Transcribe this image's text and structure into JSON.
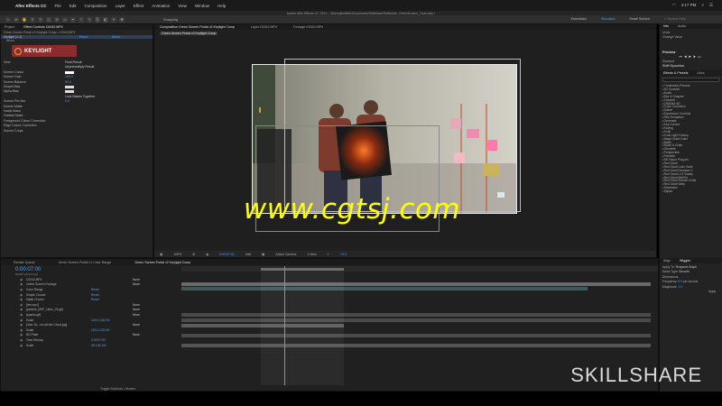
{
  "menubar": {
    "app_name": "After Effects CC",
    "items": [
      "File",
      "Edit",
      "Composition",
      "Layer",
      "Effect",
      "Animation",
      "View",
      "Window",
      "Help"
    ],
    "clock": "4:17 PM"
  },
  "title_path": "Adobe After Effects CC 2014 - /Users/jewilhite/Documents/Skillshare/Skillshare_GreenScreen_Tools.aep *",
  "toolbar": {
    "snapping_label": "Snapping",
    "workspaces": [
      "Essentials",
      "Standard",
      "Small Screen"
    ],
    "active_workspace": "Standard",
    "search_placeholder": "Search Help"
  },
  "effect_controls": {
    "tabs": [
      "Project",
      "Effect Controls C0042.MP4"
    ],
    "breadcrumb": "Green Screen Portal v2 Keylight Comp • C0042.MP4",
    "effect_row": {
      "name": "Keylight (1.2)",
      "reset": "Reset",
      "about": "About..."
    },
    "about_label": "About",
    "keylight_logo_text": "KEYLIGHT",
    "rows": [
      {
        "k": "View",
        "v": "Final Result"
      },
      {
        "k": "",
        "v": "Unpremultiply Result"
      },
      {
        "k": "Screen Colour",
        "v": ""
      },
      {
        "k": "Screen Gain",
        "v": "100.0"
      },
      {
        "k": "Screen Balance",
        "v": "50.0"
      },
      {
        "k": "Despill Bias",
        "v": ""
      },
      {
        "k": "Alpha Bias",
        "v": ""
      },
      {
        "k": "",
        "v": "Lock Biases Together"
      },
      {
        "k": "Screen Pre-blur",
        "v": "0.0"
      },
      {
        "k": "Screen Matte",
        "v": ""
      },
      {
        "k": "Inside Mask",
        "v": ""
      },
      {
        "k": "Outside Mask",
        "v": ""
      },
      {
        "k": "Foreground Colour Correction",
        "v": ""
      },
      {
        "k": "Edge Colour Correction",
        "v": ""
      },
      {
        "k": "Source Crops",
        "v": ""
      }
    ]
  },
  "viewer": {
    "tabs": [
      "Composition Green Screen Portal v2 Keylight Comp",
      "Layer C0042.MP4",
      "Footage C0042.MP4"
    ],
    "active_comp_label": "Green Screen Portal v2 Keylight Comp",
    "bottom_bar": {
      "zoom": "100%",
      "timecode": "0:00:07:01",
      "resolution": "Half",
      "camera": "Active Camera",
      "view": "1 View",
      "exposure": "+0.0"
    }
  },
  "info_panel": {
    "tabs": [
      "Info",
      "Audio"
    ],
    "lines": [
      "Undo",
      "Change Value"
    ],
    "preview_head": "Preview",
    "shortcut_label": "Shortcut",
    "shortcut_value": "Shift+Spacebar",
    "fx_tabs": [
      "Effects & Presets",
      "Libra"
    ],
    "fx_items": [
      "* Animation Presets",
      "3D Channel",
      "Audio",
      "Blur & Sharpen",
      "Channel",
      "CINEMA 4D",
      "Color Correction",
      "Distort",
      "Expression Controls",
      "Film Emulation",
      "Generate",
      "Key Correct",
      "Keying",
      "Knoll",
      "Knoll Light Factory",
      "Magic Bullet Suite",
      "Matte",
      "Noise & Grain",
      "Obsolete",
      "Perspective",
      "Primatte",
      "RE:Vision Plug-ins",
      "Red Giant",
      "Red Giant Color Suite",
      "Red Giant Denoiser II",
      "Red Giant LUT Buddy",
      "Red Giant MisFire",
      "Red Giant Shooter Suite",
      "Red Giant Warp",
      "Simulation",
      "Stylize"
    ]
  },
  "timeline": {
    "tabs": [
      "Render Queue",
      "Green Screen Portal v1 Color Range",
      "Green Screen Portal v2 Keylight Comp"
    ],
    "active_tab": "Green Screen Portal v2 Keylight Comp",
    "timecode": "0:00:07:00",
    "frame_info": "00168 (23.976 fps)",
    "layers": [
      {
        "num": "",
        "name": "C0042.MP4",
        "val": "",
        "mode": "None"
      },
      {
        "num": "",
        "name": "Green Screen Footage",
        "val": "",
        "mode": "None"
      },
      {
        "num": "",
        "name": "Color Range",
        "val": "Reset",
        "mode": ""
      },
      {
        "num": "",
        "name": "Simple Choker",
        "val": "Reset",
        "mode": ""
      },
      {
        "num": "",
        "name": "Matte Choker",
        "val": "Reset",
        "mode": ""
      },
      {
        "num": "",
        "name": "[fire.mp4]",
        "val": "",
        "mode": "None"
      },
      {
        "num": "",
        "name": "[particle_MSF_video_00.gif]",
        "val": "",
        "mode": "None"
      },
      {
        "num": "",
        "name": "[sparks.gif]",
        "val": "",
        "mode": "None"
      },
      {
        "num": "",
        "name": "Scale",
        "val": "100.0,100.0%",
        "mode": ""
      },
      {
        "num": "",
        "name": "[Inter-Sc...ed-off-the-Cloud.jpg]",
        "val": "",
        "mode": "None"
      },
      {
        "num": "",
        "name": "Scale",
        "val": "100.0,100.0%",
        "mode": ""
      },
      {
        "num": "",
        "name": "BG Plate",
        "val": "",
        "mode": "None"
      },
      {
        "num": "",
        "name": "Time Remap",
        "val": "0:00:07:00",
        "mode": ""
      },
      {
        "num": "",
        "name": "Scale",
        "val": "50.0,50.0%",
        "mode": ""
      }
    ],
    "bottom_label": "Toggle Switches / Modes"
  },
  "align_panel": {
    "tabs": [
      "Align",
      "Wiggler"
    ],
    "apply_to_label": "Apply To:",
    "apply_to_value": "Temporal Graph",
    "noise_type_label": "Noise Type:",
    "noise_type_value": "Smooth",
    "dimensions_label": "Dimensions:",
    "frequency_label": "Frequency:",
    "frequency_value": "5.0",
    "frequency_unit": "per second",
    "magnitude_label": "Magnitude:",
    "magnitude_value": "1.0",
    "apply_button": "Apply"
  },
  "watermark_text": "www.cgtsj.com",
  "skillshare_logo": "SKILLSHARE",
  "colors": {
    "accent_blue": "#4aa3ff",
    "watermark_yellow": "#ffff00",
    "keylight_red": "#8b2d2d"
  }
}
